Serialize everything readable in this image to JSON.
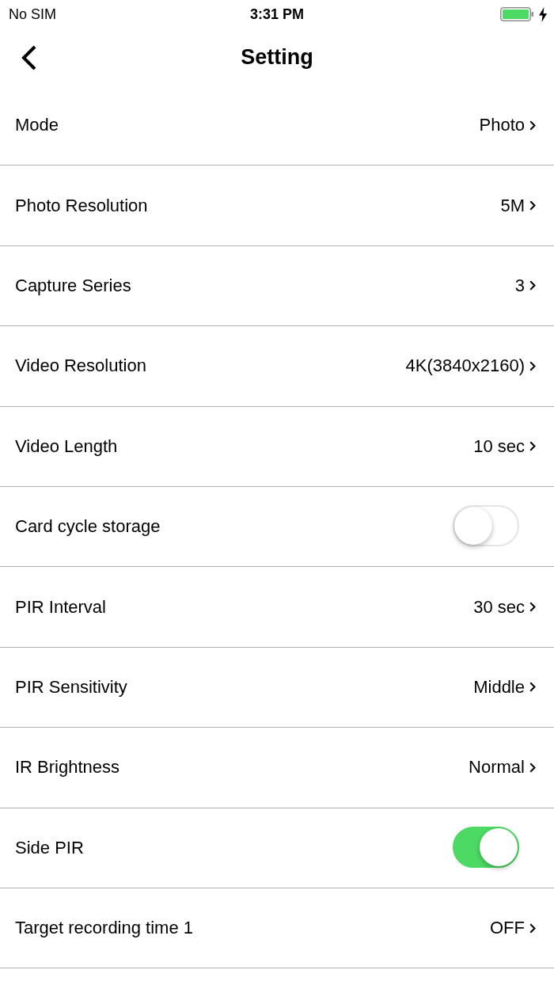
{
  "status_bar": {
    "carrier": "No SIM",
    "time": "3:31 PM"
  },
  "nav_bar": {
    "title": "Setting"
  },
  "settings": [
    {
      "kind": "value",
      "label": "Mode",
      "value": "Photo"
    },
    {
      "kind": "value",
      "label": "Photo Resolution",
      "value": "5M"
    },
    {
      "kind": "value",
      "label": "Capture Series",
      "value": "3"
    },
    {
      "kind": "value",
      "label": "Video Resolution",
      "value": "4K(3840x2160)"
    },
    {
      "kind": "value",
      "label": "Video Length",
      "value": "10 sec"
    },
    {
      "kind": "toggle",
      "label": "Card cycle storage",
      "on": false
    },
    {
      "kind": "value",
      "label": "PIR Interval",
      "value": "30 sec"
    },
    {
      "kind": "value",
      "label": "PIR Sensitivity",
      "value": "Middle"
    },
    {
      "kind": "value",
      "label": "IR Brightness",
      "value": "Normal"
    },
    {
      "kind": "toggle",
      "label": "Side PIR",
      "on": true
    },
    {
      "kind": "value",
      "label": "Target recording time 1",
      "value": "OFF"
    }
  ]
}
